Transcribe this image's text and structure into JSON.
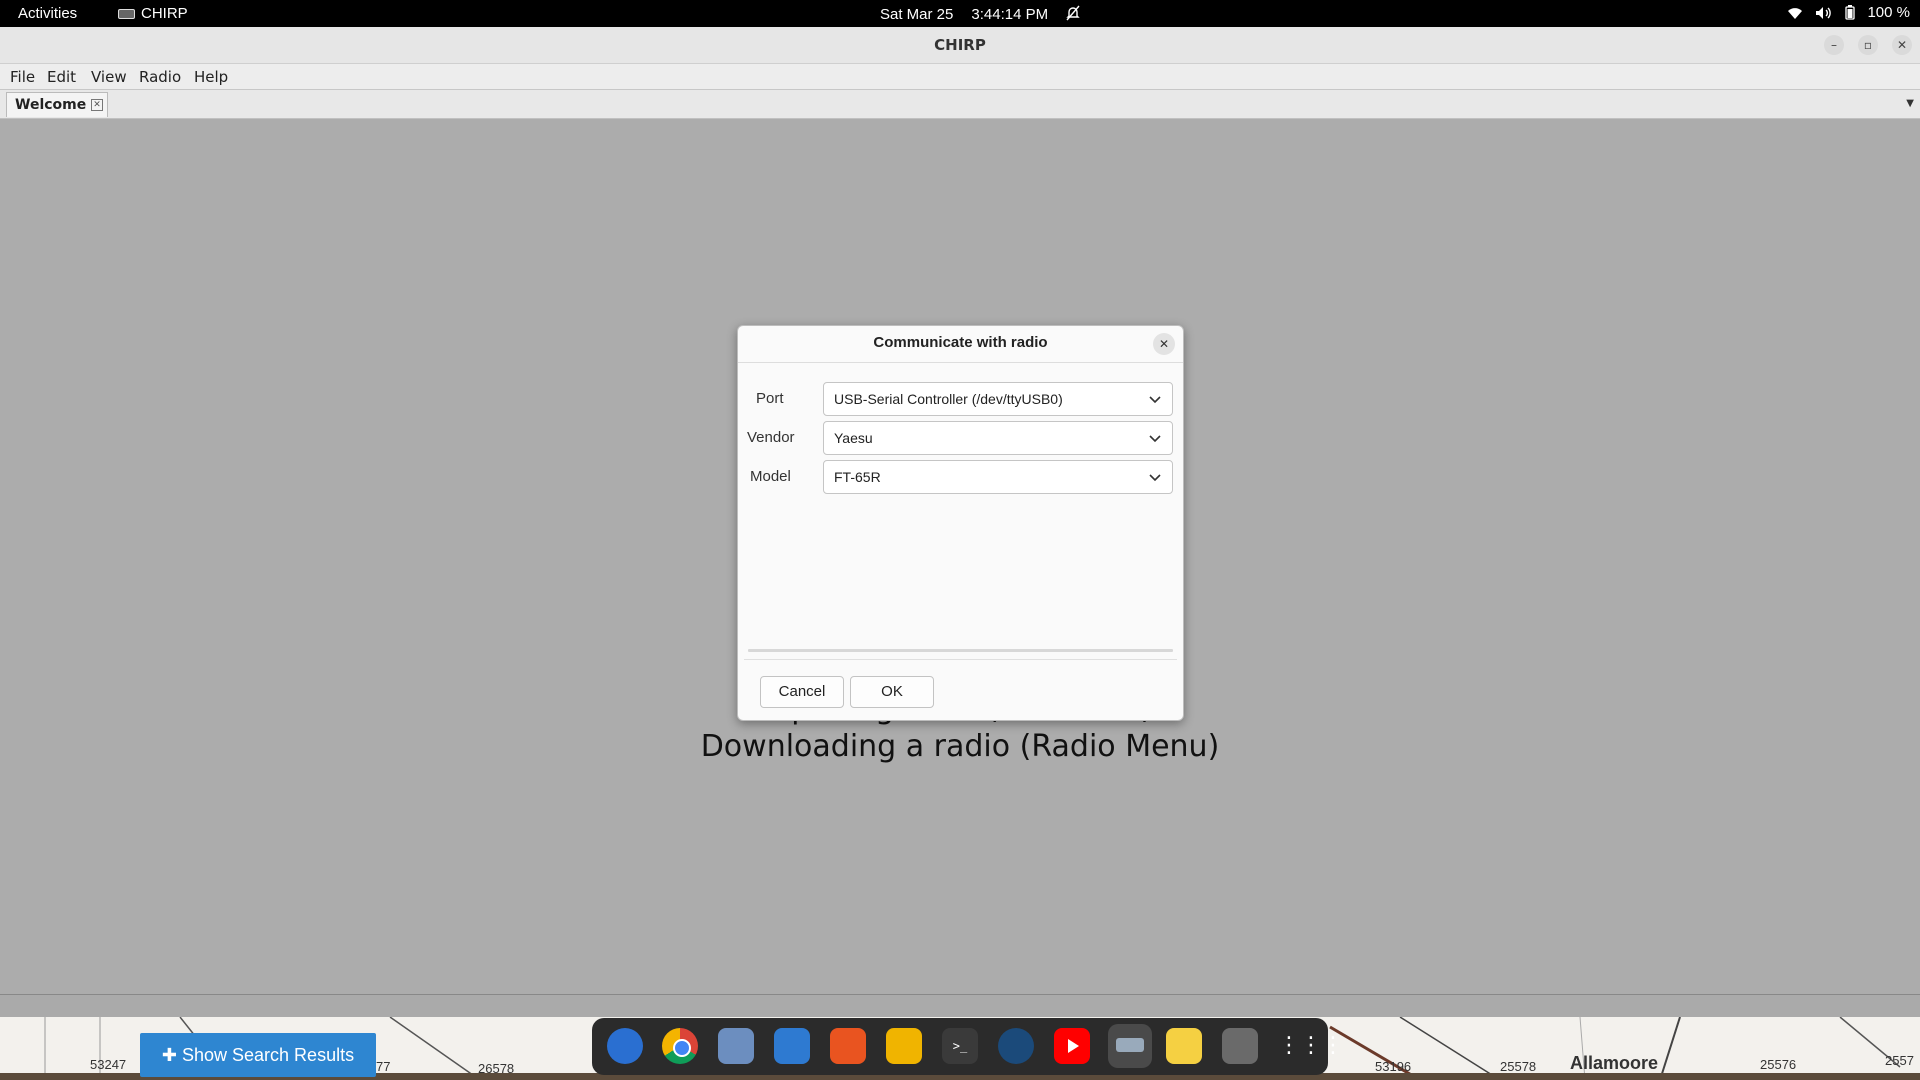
{
  "topbar": {
    "activities": "Activities",
    "app": "CHIRP",
    "date": "Sat Mar 25",
    "time": "3:44:14 PM",
    "battery": "100 %"
  },
  "window": {
    "title": "CHIRP"
  },
  "menubar": {
    "items": [
      "File",
      "Edit",
      "View",
      "Radio",
      "Help"
    ]
  },
  "tabs": [
    {
      "label": "Welcome"
    }
  ],
  "welcome": {
    "line1": "Opening a file (File Menu)",
    "line2": "Downloading a radio (Radio Menu)"
  },
  "dialog": {
    "title": "Communicate with radio",
    "port_label": "Port",
    "port_value": "USB-Serial Controller (/dev/ttyUSB0)",
    "vendor_label": "Vendor",
    "vendor_value": "Yaesu",
    "model_label": "Model",
    "model_value": "FT-65R",
    "cancel": "Cancel",
    "ok": "OK"
  },
  "background": {
    "search_button": "Show Search Results",
    "map_numbers": [
      "53247",
      "77",
      "26578",
      "53196",
      "25578",
      "Allamoore",
      "25576",
      "2557"
    ]
  },
  "dock": {
    "icons": [
      "thunderbird-icon",
      "chrome-icon",
      "files-icon",
      "text-editor-icon",
      "app-center-icon",
      "calculator-icon",
      "terminal-icon",
      "steam-icon",
      "youtube-icon",
      "chirp-icon",
      "notes-icon",
      "trash-icon",
      "app-grid-icon"
    ]
  },
  "colors": {
    "accent": "#2e86d1",
    "topbar": "#000000",
    "main_bg": "#acacac"
  }
}
